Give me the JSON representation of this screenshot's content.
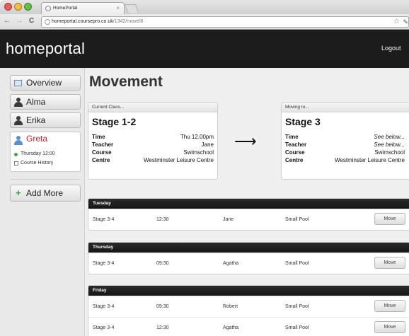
{
  "browser": {
    "tab_title": "HomePortal",
    "tab_close": "×",
    "nav": {
      "back": "←",
      "forward": "→",
      "reload": "C"
    },
    "url_host": "homeportal.coursepro.co.uk",
    "url_path": "/1342/move/8",
    "star": "☆",
    "wrench": "✎",
    "lights": [
      "#ee5c54",
      "#f5bd3a",
      "#5fc043"
    ]
  },
  "header": {
    "logo": "homeportal",
    "logout": "Logout"
  },
  "sidebar": {
    "overview": "Overview",
    "members": [
      "Alma",
      "Erika"
    ],
    "selected": {
      "name": "Greta",
      "next_class": "Thursday 12:00",
      "history": "Course History"
    },
    "add_more": "Add More",
    "add_icon": "+"
  },
  "main": {
    "title": "Movement",
    "arrow": "⟶",
    "current": {
      "head": "Current Class...",
      "stage": "Stage 1-2",
      "rows": [
        {
          "k": "Time",
          "v": "Thu 12.00pm"
        },
        {
          "k": "Teacher",
          "v": "Jane"
        },
        {
          "k": "Course",
          "v": "Swimschool"
        },
        {
          "k": "Centre",
          "v": "Westminster Leisure Centre"
        }
      ]
    },
    "moving": {
      "head": "Moving to...",
      "stage": "Stage 3",
      "rows": [
        {
          "k": "Time",
          "v": "See below..."
        },
        {
          "k": "Teacher",
          "v": "See below..."
        },
        {
          "k": "Course",
          "v": "Swimschool"
        },
        {
          "k": "Centre",
          "v": "Westminster Leisure Centre"
        }
      ]
    },
    "days": [
      {
        "name": "Tuesday",
        "rows": [
          {
            "stage": "Stage 3-4",
            "time": "12:30",
            "teacher": "Jane",
            "pool": "Small Pool",
            "action": "Move"
          }
        ]
      },
      {
        "name": "Thursday",
        "rows": [
          {
            "stage": "Stage 3-4",
            "time": "09:30",
            "teacher": "Agatha",
            "pool": "Small Pool",
            "action": "Move"
          }
        ]
      },
      {
        "name": "Friday",
        "rows": [
          {
            "stage": "Stage 3-4",
            "time": "09:30",
            "teacher": "Robert",
            "pool": "Small Pool",
            "action": "Move"
          },
          {
            "stage": "Stage 3-4",
            "time": "12:30",
            "teacher": "Agatha",
            "pool": "Small Pool",
            "action": "Move"
          }
        ]
      }
    ]
  }
}
